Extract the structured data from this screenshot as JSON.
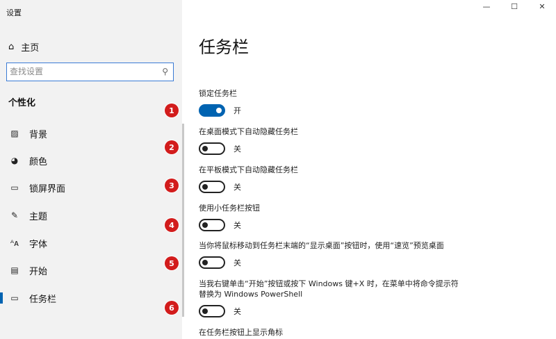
{
  "window": {
    "title": "设置",
    "minimize": "—",
    "maximize": "☐",
    "close": "✕"
  },
  "sidebar": {
    "home_label": "主页",
    "home_icon": "home-icon",
    "search_placeholder": "查找设置",
    "search_icon": "search-icon",
    "section_title": "个性化",
    "items": [
      {
        "label": "背景",
        "icon": "picture-icon"
      },
      {
        "label": "颜色",
        "icon": "palette-icon"
      },
      {
        "label": "锁屏界面",
        "icon": "lock-screen-icon"
      },
      {
        "label": "主题",
        "icon": "theme-brush-icon"
      },
      {
        "label": "字体",
        "icon": "font-icon"
      },
      {
        "label": "开始",
        "icon": "start-menu-icon"
      },
      {
        "label": "任务栏",
        "icon": "taskbar-icon",
        "active": true
      }
    ]
  },
  "annotations": [
    "1",
    "2",
    "3",
    "4",
    "5",
    "6"
  ],
  "main": {
    "title": "任务栏",
    "settings": [
      {
        "label": "锁定任务栏",
        "state": "开",
        "on": true
      },
      {
        "label": "在桌面模式下自动隐藏任务栏",
        "state": "关",
        "on": false
      },
      {
        "label": "在平板模式下自动隐藏任务栏",
        "state": "关",
        "on": false
      },
      {
        "label": "使用小任务栏按钮",
        "state": "关",
        "on": false
      },
      {
        "label": "当你将鼠标移动到任务栏末端的“显示桌面”按钮时，使用“速览”预览桌面",
        "state": "关",
        "on": false
      },
      {
        "label": "当我右键单击“开始”按钮或按下 Windows 键+X 时，在菜单中将命令提示符替换为 Windows PowerShell",
        "state": "关",
        "on": false
      },
      {
        "label": "在任务栏按钮上显示角标"
      }
    ]
  },
  "colors": {
    "accent": "#0063b1",
    "badge": "#d21c1c",
    "sidebar_bg": "#f2f2f2"
  }
}
